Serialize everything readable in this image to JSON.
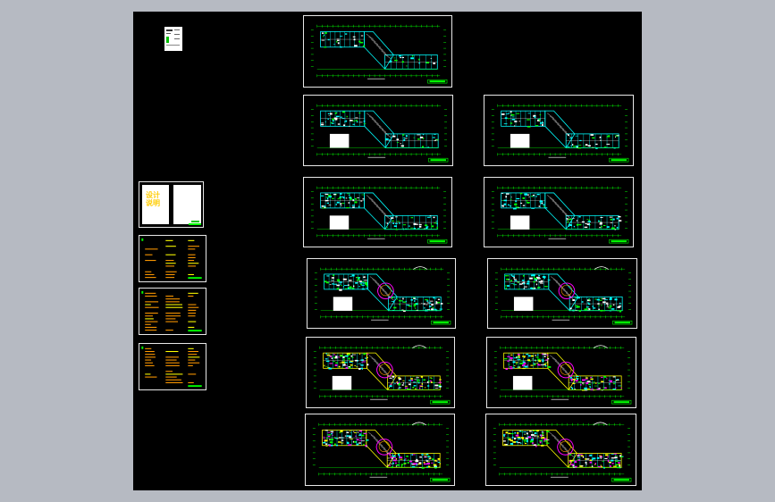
{
  "colors": {
    "background": "#b6bac2",
    "canvas": "#000000",
    "sheet_border": "#e8e8e8",
    "cyan": "#00ffff",
    "green": "#00ff00",
    "yellow": "#ffff00",
    "magenta": "#ff00ff",
    "white": "#ffffff",
    "orange": "#ff9900"
  },
  "cover": {
    "text": "设计\n说明"
  },
  "sheets": [
    {
      "id": "roof-plan"
    },
    {
      "id": "floor-plan-left-1"
    },
    {
      "id": "floor-plan-right-1"
    },
    {
      "id": "floor-plan-left-2"
    },
    {
      "id": "floor-plan-right-2"
    },
    {
      "id": "floor-plan-left-3"
    },
    {
      "id": "floor-plan-right-3"
    },
    {
      "id": "floor-plan-left-4"
    },
    {
      "id": "floor-plan-right-4"
    },
    {
      "id": "floor-plan-left-5"
    },
    {
      "id": "floor-plan-right-5"
    }
  ]
}
